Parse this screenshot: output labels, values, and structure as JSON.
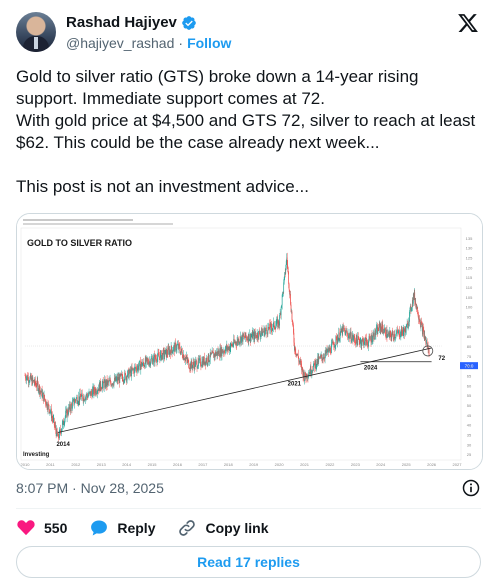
{
  "author": {
    "name": "Rashad Hajiyev",
    "handle": "@hajiyev_rashad",
    "separator": "·",
    "follow_label": "Follow"
  },
  "post": {
    "line1": "Gold to silver ratio (GTS) broke down a 14-year rising support. Immediate support comes at 72.",
    "line2": "With gold price at $4,500 and GTS 72, silver to reach at least $62. This could be the case already next week...",
    "line3": "This post is not an investment advice..."
  },
  "chart_data": {
    "type": "line",
    "title": "GOLD TO SILVER RATIO",
    "source_label": "Investing",
    "x_tick_labels": [
      "2010",
      "2011",
      "2012",
      "2013",
      "2014",
      "2015",
      "2016",
      "2017",
      "2018",
      "2019",
      "2020",
      "2021",
      "2022",
      "2023",
      "2024",
      "2025",
      "2026",
      "2027"
    ],
    "y_tick_labels": [
      "135",
      "130",
      "125",
      "120",
      "115",
      "110",
      "105",
      "100",
      "95",
      "90",
      "85",
      "80",
      "75",
      "70",
      "65",
      "60",
      "55",
      "50",
      "45",
      "40",
      "35",
      "30",
      "25"
    ],
    "ylim": [
      22,
      138
    ],
    "xlim": [
      2010,
      2027
    ],
    "annotations": [
      "2014",
      "2021",
      "2024",
      "72"
    ],
    "current_value_tag": "70.0",
    "series": [
      {
        "x": [
          2010,
          2010.5,
          2011,
          2011.3,
          2011.6,
          2012,
          2012.5,
          2013,
          2013.5,
          2014,
          2014.5,
          2015,
          2015.5,
          2016,
          2016.5,
          2017,
          2017.5,
          2018,
          2018.5,
          2019,
          2019.5,
          2020,
          2020.2,
          2020.3,
          2020.6,
          2021,
          2021.5,
          2022,
          2022.5,
          2023,
          2023.5,
          2024,
          2024.3,
          2024.6,
          2025,
          2025.3,
          2025.6,
          2025.9
        ],
        "y": [
          65,
          60,
          47,
          33,
          45,
          53,
          55,
          60,
          62,
          65,
          70,
          73,
          76,
          80,
          70,
          72,
          76,
          79,
          84,
          85,
          88,
          92,
          113,
          125,
          80,
          64,
          72,
          78,
          88,
          83,
          82,
          90,
          85,
          86,
          88,
          106,
          90,
          77
        ]
      }
    ],
    "support_line": {
      "x": [
        2011.3,
        2026.0
      ],
      "y": [
        36,
        79
      ]
    },
    "horizontal_level": 72,
    "grid": false,
    "candles_color_up": "#26a69a",
    "candles_color_down": "#ef5350"
  },
  "meta": {
    "timestamp": "8:07 PM · Nov 28, 2025"
  },
  "actions": {
    "likes_count": "550",
    "reply_label": "Reply",
    "copy_link_label": "Copy link",
    "read_replies_label": "Read 17 replies"
  },
  "colors": {
    "accent": "#1d9bf0",
    "like": "#f91880",
    "text": "#0f1419",
    "muted": "#536471"
  }
}
